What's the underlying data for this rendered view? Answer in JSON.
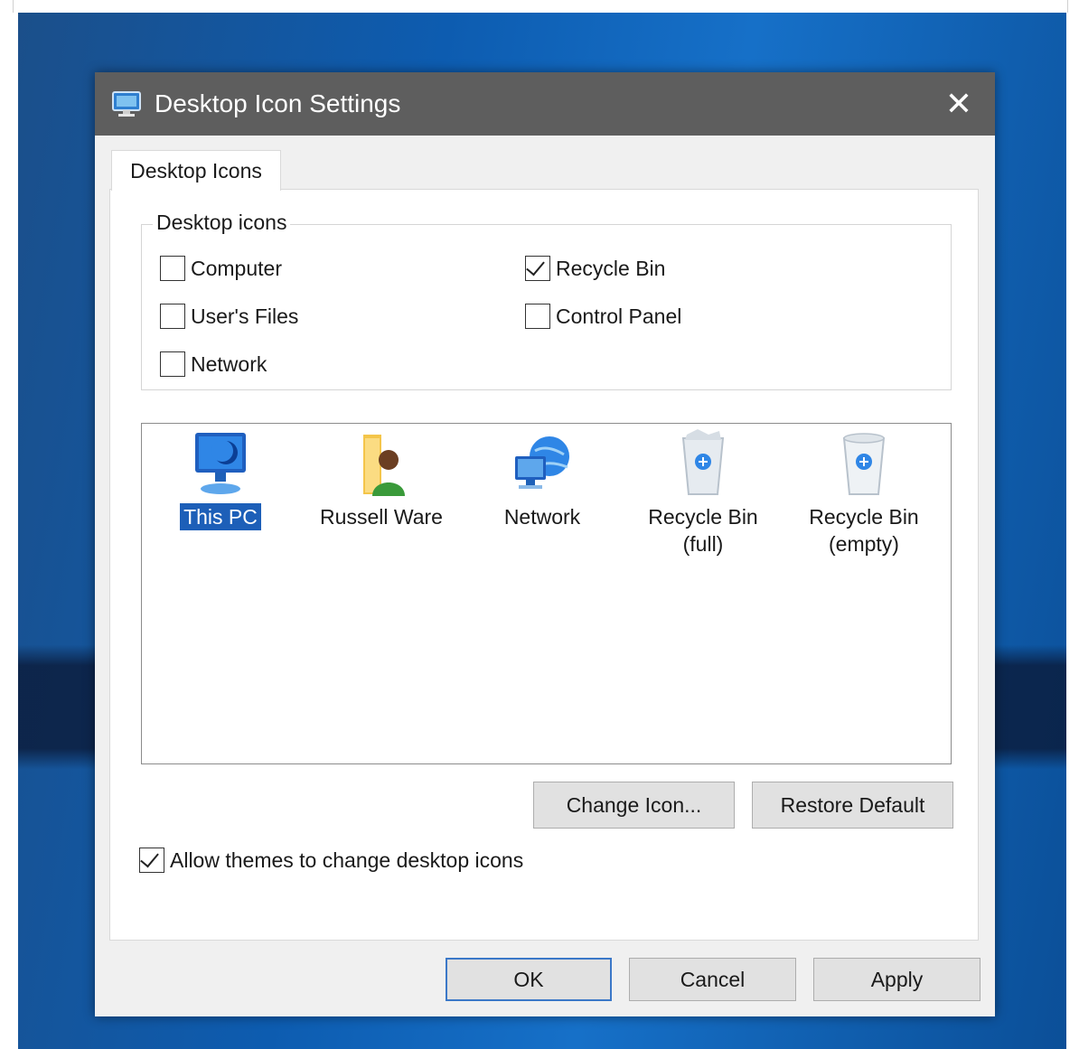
{
  "dialog": {
    "title": "Desktop Icon Settings",
    "close_glyph": "✕",
    "tab_label": "Desktop Icons",
    "group_title": "Desktop icons",
    "checkboxes": [
      {
        "label": "Computer",
        "checked": false
      },
      {
        "label": "User's Files",
        "checked": false
      },
      {
        "label": "Network",
        "checked": false
      },
      {
        "label": "Recycle Bin",
        "checked": true
      },
      {
        "label": "Control Panel",
        "checked": false
      }
    ],
    "icons": [
      {
        "label": "This PC",
        "icon": "monitor-icon",
        "selected": true
      },
      {
        "label": "Russell Ware",
        "icon": "user-folder-icon",
        "selected": false
      },
      {
        "label": "Network",
        "icon": "network-globe-icon",
        "selected": false
      },
      {
        "label": "Recycle Bin",
        "label2": "(full)",
        "icon": "recycle-bin-full-icon",
        "selected": false
      },
      {
        "label": "Recycle Bin",
        "label2": "(empty)",
        "icon": "recycle-bin-empty-icon",
        "selected": false
      }
    ],
    "change_icon_label": "Change Icon...",
    "restore_default_label": "Restore Default",
    "allow_themes": {
      "label": "Allow themes to change desktop icons",
      "checked": true
    },
    "ok_label": "OK",
    "cancel_label": "Cancel",
    "apply_label": "Apply"
  },
  "colors": {
    "titlebar": "#5e5e5e",
    "selection": "#1d5fb8",
    "default_button_border": "#3b78c8"
  }
}
